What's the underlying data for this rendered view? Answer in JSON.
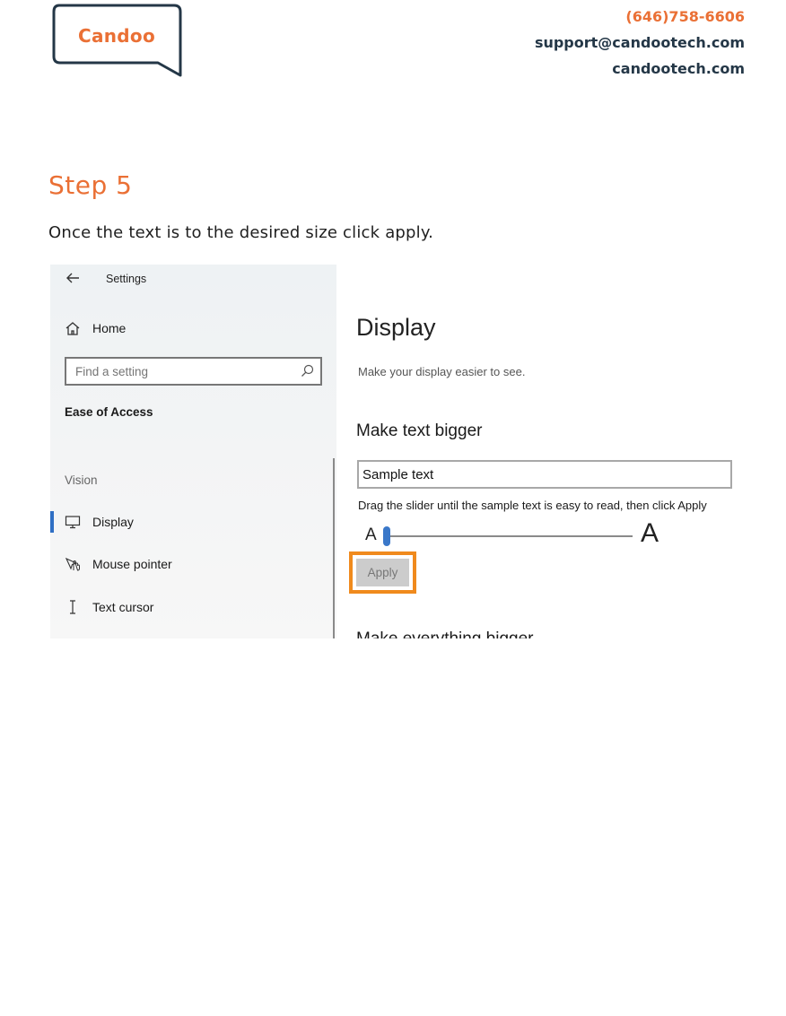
{
  "header": {
    "logo_text": "Candoo",
    "phone": "(646)758-6606",
    "email": "support@candootech.com",
    "website": "candootech.com"
  },
  "step": {
    "title": "Step 5",
    "instruction": "Once the text is to the desired size click apply."
  },
  "screenshot": {
    "settings_title": "Settings",
    "home_label": "Home",
    "search_placeholder": "Find a setting",
    "section_title": "Ease of Access",
    "vision_label": "Vision",
    "nav_items": [
      {
        "label": "Display",
        "icon": "monitor-icon",
        "selected": true
      },
      {
        "label": "Mouse pointer",
        "icon": "mouse-pointer-icon",
        "selected": false
      },
      {
        "label": "Text cursor",
        "icon": "text-cursor-icon",
        "selected": false
      }
    ],
    "page_title": "Display",
    "page_subtitle": "Make your display easier to see.",
    "text_size_heading": "Make text bigger",
    "sample_text": "Sample text",
    "slider_hint": "Drag the slider until the sample text is easy to read, then click Apply",
    "slider_small_label": "A",
    "slider_large_label": "A",
    "slider_level_percent": 0,
    "apply_label": "Apply",
    "next_heading_partial": "Make everything bigger"
  },
  "colors": {
    "brand_orange": "#ea7035",
    "brand_navy": "#243747",
    "highlight": "#f08a1d",
    "accent_blue": "#2f6fc4"
  }
}
